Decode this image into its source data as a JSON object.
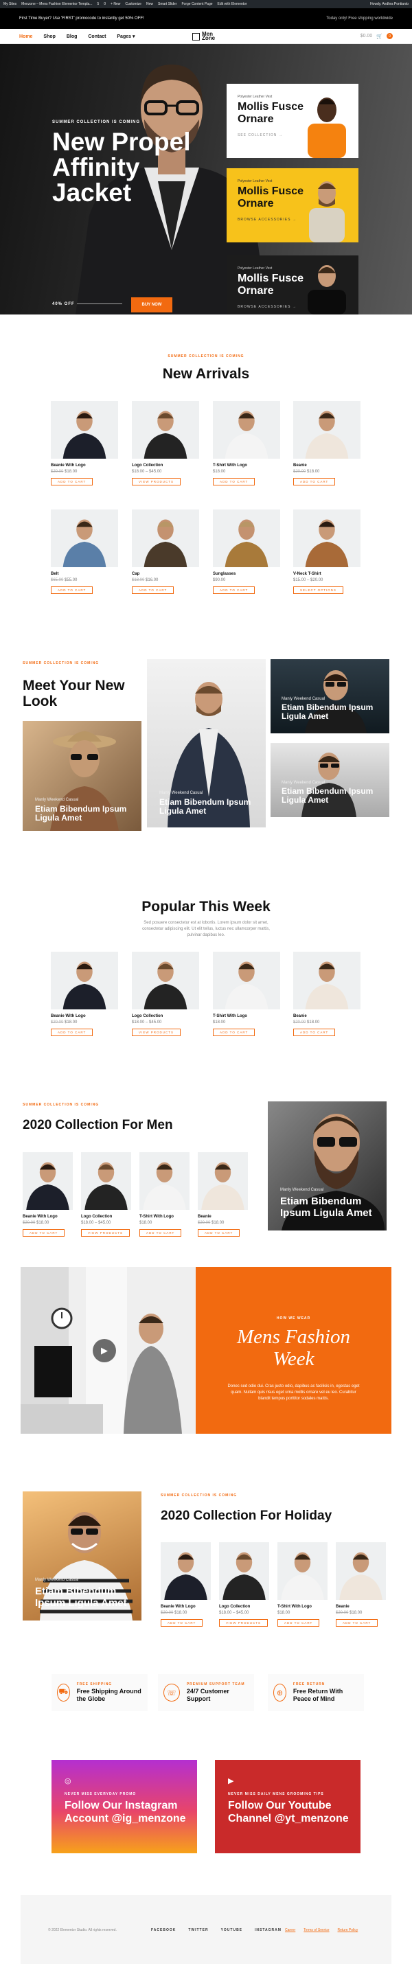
{
  "admin_bar": {
    "items": [
      "My Sites",
      "Menzone – Mens Fashion Elementor Templa...",
      "5",
      "0",
      "+ New",
      "Customize",
      "New",
      "Smart Slider",
      "Forge Content Page",
      "Edit with Elementor"
    ],
    "howdy": "Howdy, Andhra Pontianto"
  },
  "topbar": {
    "left": "First Time Buyer? Use 'FIRST' promocode to instantly get 50% OFF!",
    "right": "Today only! Free shipping worldwide"
  },
  "header": {
    "nav": [
      "Home",
      "Shop",
      "Blog",
      "Contact",
      "Pages"
    ],
    "logo_line1": "Men",
    "logo_line2": "Zone",
    "cart": "$0.00",
    "cart_count": "0"
  },
  "hero": {
    "kicker": "SUMMER COLLECTION IS COMING",
    "title": "New Propel Affinity Jacket",
    "offer": "40% OFF",
    "button": "BUY NOW",
    "cards": [
      {
        "kicker": "Polyester Leather Vest",
        "title": "Mollis Fusce Ornare",
        "link": "SEE COLLECTION →"
      },
      {
        "kicker": "Polyester Leather Vest",
        "title": "Mollis Fusce Ornare",
        "link": "BROWSE ACCESSORIES →"
      },
      {
        "kicker": "Polyester Leather Vest",
        "title": "Mollis Fusce Ornare",
        "link": "BROWSE ACCESSORIES →"
      }
    ]
  },
  "new_arrivals": {
    "kicker": "SUMMER COLLECTION IS COMING",
    "title": "New Arrivals",
    "products": [
      {
        "name": "Beanie With Logo",
        "old": "$20.00",
        "price": "$18.00",
        "button": "ADD TO CART"
      },
      {
        "name": "Logo Collection",
        "old": "",
        "price": "$18.00 – $45.00",
        "button": "VIEW PRODUCTS"
      },
      {
        "name": "T-Shirt With Logo",
        "old": "",
        "price": "$18.00",
        "button": "ADD TO CART"
      },
      {
        "name": "Beanie",
        "old": "$20.00",
        "price": "$18.00",
        "button": "ADD TO CART"
      },
      {
        "name": "Belt",
        "old": "$65.00",
        "price": "$55.00",
        "button": "ADD TO CART"
      },
      {
        "name": "Cap",
        "old": "$18.00",
        "price": "$16.00",
        "button": "ADD TO CART"
      },
      {
        "name": "Sunglasses",
        "old": "",
        "price": "$90.00",
        "button": "ADD TO CART"
      },
      {
        "name": "V-Neck T-Shirt",
        "old": "",
        "price": "$15.00 – $20.00",
        "button": "SELECT OPTIONS"
      }
    ]
  },
  "new_look": {
    "kicker": "SUMMER COLLECTION IS COMING",
    "title": "Meet Your New Look",
    "cards": [
      {
        "kicker": "Manly Weekend Casual",
        "title": "Etiam Bibendum Ipsum Ligula Amet"
      },
      {
        "kicker": "Manly Weekend Casual",
        "title": "Etiam Bibendum Ipsum Ligula Amet"
      },
      {
        "kicker": "Manly Weekend Casual",
        "title": "Etiam Bibendum Ipsum Ligula Amet"
      },
      {
        "kicker": "Manly Weekend Casual",
        "title": "Etiam Bibendum Ipsum Ligula Amet"
      }
    ]
  },
  "popular": {
    "title": "Popular This Week",
    "text": "Sed posuere consectetur est at lobortis. Lorem ipsum dolor sit amet, consectetur adipiscing elit. Ut elit tellus, luctus nec ullamcorper mattis, pulvinar dapibus leo.",
    "products": [
      {
        "name": "Beanie With Logo",
        "old": "$20.00",
        "price": "$18.00",
        "button": "ADD TO CART"
      },
      {
        "name": "Logo Collection",
        "old": "",
        "price": "$18.00 – $45.00",
        "button": "VIEW PRODUCTS"
      },
      {
        "name": "T-Shirt With Logo",
        "old": "",
        "price": "$18.00",
        "button": "ADD TO CART"
      },
      {
        "name": "Beanie",
        "old": "$20.00",
        "price": "$18.00",
        "button": "ADD TO CART"
      }
    ]
  },
  "men_collection": {
    "kicker": "SUMMER COLLECTION IS COMING",
    "title": "2020 Collection For Men",
    "products": [
      {
        "name": "Beanie With Logo",
        "old": "$20.00",
        "price": "$18.00",
        "button": "ADD TO CART"
      },
      {
        "name": "Logo Collection",
        "old": "",
        "price": "$18.00 – $45.00",
        "button": "VIEW PRODUCTS"
      },
      {
        "name": "T-Shirt With Logo",
        "old": "",
        "price": "$18.00",
        "button": "ADD TO CART"
      },
      {
        "name": "Beanie",
        "old": "$20.00",
        "price": "$18.00",
        "button": "ADD TO CART"
      }
    ],
    "card": {
      "kicker": "Manly Weekend Casual",
      "title": "Etiam Bibendum Ipsum Ligula Amet"
    }
  },
  "mens_week": {
    "kicker": "HOW WE WEAR",
    "title": "Mens Fashion Week",
    "text": "Donec sed odio dui. Cras justo odio, dapibus ac facilisis in, egestas eget quam. Nullam quis risus eget urna mollis ornare vel eu leo. Curabitur blandit tempus porttitor sodales mattis."
  },
  "holiday": {
    "kicker": "SUMMER COLLECTION IS COMING",
    "title": "2020 Collection For Holiday",
    "card": {
      "kicker": "Manly Weekend Casual",
      "title": "Etiam Bibendum Ipsum Ligula Amet"
    },
    "products": [
      {
        "name": "Beanie With Logo",
        "old": "$20.00",
        "price": "$18.00",
        "button": "ADD TO CART"
      },
      {
        "name": "Logo Collection",
        "old": "",
        "price": "$18.00 – $45.00",
        "button": "VIEW PRODUCTS"
      },
      {
        "name": "T-Shirt With Logo",
        "old": "",
        "price": "$18.00",
        "button": "ADD TO CART"
      },
      {
        "name": "Beanie",
        "old": "$20.00",
        "price": "$18.00",
        "button": "ADD TO CART"
      }
    ]
  },
  "features": [
    {
      "kicker": "FREE SHIPPING",
      "title": "Free Shipping Around the Globe"
    },
    {
      "kicker": "PREMIUM SUPPORT TEAM",
      "title": "24/7 Customer Support"
    },
    {
      "kicker": "FREE RETURN",
      "title": "Free Return With Peace of Mind"
    }
  ],
  "social": [
    {
      "kicker": "NEVER MISS EVERYDAY PROMO",
      "title": "Follow Our Instagram Account @ig_menzone"
    },
    {
      "kicker": "NEVER MISS DAILY MENS GROOMING TIPS",
      "title": "Follow Our Youtube Channel @yt_menzone"
    }
  ],
  "footer": {
    "copyright": "© 2022 Elementor Studio. All rights reserved.",
    "social": [
      "FACEBOOK",
      "TWITTER",
      "YOUTUBE",
      "INSTAGRAM"
    ],
    "links": [
      "Career",
      "Terms of Service",
      "Return Policy"
    ]
  },
  "colors": {
    "accent": "#f26a10",
    "yellow": "#f7c21b",
    "dark": "#111111"
  }
}
